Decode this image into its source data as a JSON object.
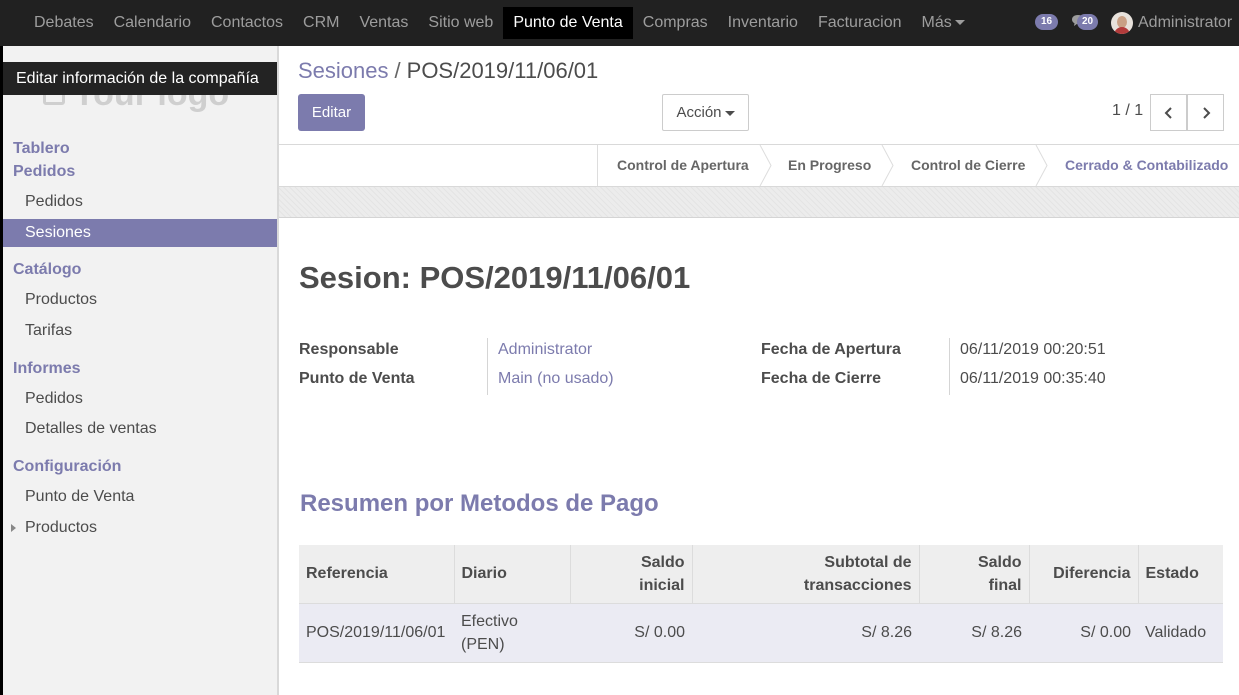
{
  "topbar": {
    "menu": [
      "Debates",
      "Calendario",
      "Contactos",
      "CRM",
      "Ventas",
      "Sitio web",
      "Punto de Venta",
      "Compras",
      "Inventario",
      "Facturacion",
      "Más"
    ],
    "active_index": 6,
    "activity_count": "16",
    "message_count": "20",
    "user_name": "Administrator"
  },
  "sidebar": {
    "logo_text": "Your logo",
    "logo_tooltip": "Editar información de la compañía",
    "dashboard": "Tablero",
    "orders_heading": "Pedidos",
    "orders_item": "Pedidos",
    "sessions_item": "Sesiones",
    "catalog_heading": "Catálogo",
    "products_item": "Productos",
    "pricelists_item": "Tarifas",
    "reports_heading": "Informes",
    "report_orders_item": "Pedidos",
    "sales_details_item": "Detalles de ventas",
    "config_heading": "Configuración",
    "pos_item": "Punto de Venta",
    "config_products_item": "Productos"
  },
  "control": {
    "breadcrumb_link": "Sesiones",
    "breadcrumb_sep": "/",
    "breadcrumb_current": "POS/2019/11/06/01",
    "edit_label": "Editar",
    "action_label": "Acción",
    "pager": "1 / 1"
  },
  "statusbar": {
    "stages": [
      "Control de Apertura",
      "En Progreso",
      "Control de Cierre",
      "Cerrado & Contabilizado"
    ],
    "current_index": 3
  },
  "sheet": {
    "title": "Sesion: POS/2019/11/06/01",
    "fields": {
      "responsible_label": "Responsable",
      "responsible_value": "Administrator",
      "pos_label": "Punto de Venta",
      "pos_value": "Main (no usado)",
      "open_label": "Fecha de Apertura",
      "open_value": "06/11/2019 00:20:51",
      "close_label": "Fecha de Cierre",
      "close_value": "06/11/2019 00:35:40"
    },
    "section_title": "Resumen por Metodos de Pago",
    "table": {
      "headers": {
        "reference": "Referencia",
        "journal": "Diario",
        "start_1": "Saldo",
        "start_2": "inicial",
        "subtotal_1": "Subtotal de",
        "subtotal_2": "transacciones",
        "end_1": "Saldo",
        "end_2": "final",
        "difference": "Diferencia",
        "state": "Estado"
      },
      "rows": [
        {
          "reference": "POS/2019/11/06/01",
          "journal_1": "Efectivo",
          "journal_2": "(PEN)",
          "start": "S/ 0.00",
          "subtotal": "S/ 8.26",
          "end": "S/ 8.26",
          "difference": "S/ 0.00",
          "state": "Validado"
        }
      ]
    }
  },
  "colors": {
    "accent": "#7c7bad",
    "topbar": "#212121"
  }
}
